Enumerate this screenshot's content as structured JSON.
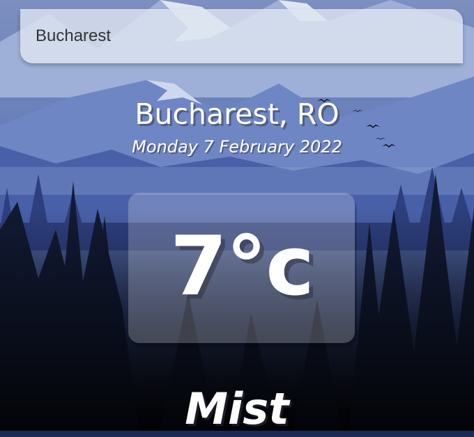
{
  "search": {
    "value": "Bucharest"
  },
  "location": {
    "label": "Bucharest, RO"
  },
  "date": {
    "label": "Monday 7 February 2022"
  },
  "temperature": {
    "label": "7°c"
  },
  "weather": {
    "label": "Mist"
  }
}
